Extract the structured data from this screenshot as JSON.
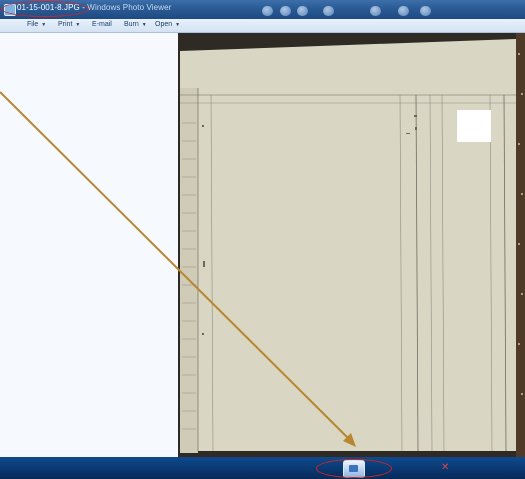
{
  "window": {
    "file_name": "01-15-001-8.JPG",
    "title_separator": " - ",
    "app_name": "Windows Photo Viewer"
  },
  "menu": {
    "items": [
      {
        "label": "File",
        "has_caret": true
      },
      {
        "label": "Print",
        "has_caret": true
      },
      {
        "label": "E-mail",
        "has_caret": false
      },
      {
        "label": "Burn",
        "has_caret": true
      },
      {
        "label": "Open",
        "has_caret": true
      }
    ]
  },
  "photo": {
    "description_subject": "ledger-page",
    "page_color": "#d9d6c3",
    "line_color": "#8f8c80"
  },
  "controls": {
    "buttons": [
      "zoom-icon",
      "actual-size-icon",
      "previous-icon",
      "slideshow-icon",
      "next-icon",
      "rotate-left-icon",
      "rotate-right-icon",
      "delete-icon"
    ]
  },
  "annotations": {
    "oval_color": "#c8262b",
    "arrow_color": "#b8862f"
  }
}
